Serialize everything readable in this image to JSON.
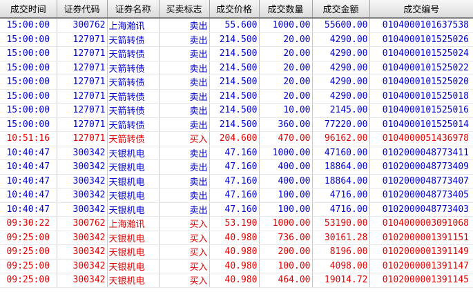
{
  "columns": [
    "成交时间",
    "证券代码",
    "证券名称",
    "买卖标志",
    "成交价格",
    "成交数量",
    "成交金额",
    "成交编号"
  ],
  "colors": {
    "sell": "#0000d0",
    "buy": "#e00000"
  },
  "rows": [
    {
      "side": "sell",
      "time": "15:00:00",
      "code": "300762",
      "name": "上海瀚讯",
      "dir": "卖出",
      "price": "55.600",
      "qty": "1000.00",
      "amount": "55600.00",
      "no": "0104000101637538"
    },
    {
      "side": "sell",
      "time": "15:00:00",
      "code": "127071",
      "name": "天箭转债",
      "dir": "卖出",
      "price": "214.500",
      "qty": "20.00",
      "amount": "4290.00",
      "no": "0104000101525026"
    },
    {
      "side": "sell",
      "time": "15:00:00",
      "code": "127071",
      "name": "天箭转债",
      "dir": "卖出",
      "price": "214.500",
      "qty": "20.00",
      "amount": "4290.00",
      "no": "0104000101525024"
    },
    {
      "side": "sell",
      "time": "15:00:00",
      "code": "127071",
      "name": "天箭转债",
      "dir": "卖出",
      "price": "214.500",
      "qty": "20.00",
      "amount": "4290.00",
      "no": "0104000101525022"
    },
    {
      "side": "sell",
      "time": "15:00:00",
      "code": "127071",
      "name": "天箭转债",
      "dir": "卖出",
      "price": "214.500",
      "qty": "20.00",
      "amount": "4290.00",
      "no": "0104000101525020"
    },
    {
      "side": "sell",
      "time": "15:00:00",
      "code": "127071",
      "name": "天箭转债",
      "dir": "卖出",
      "price": "214.500",
      "qty": "20.00",
      "amount": "4290.00",
      "no": "0104000101525018"
    },
    {
      "side": "sell",
      "time": "15:00:00",
      "code": "127071",
      "name": "天箭转债",
      "dir": "卖出",
      "price": "214.500",
      "qty": "10.00",
      "amount": "2145.00",
      "no": "0104000101525016"
    },
    {
      "side": "sell",
      "time": "15:00:00",
      "code": "127071",
      "name": "天箭转债",
      "dir": "卖出",
      "price": "214.500",
      "qty": "360.00",
      "amount": "77220.00",
      "no": "0104000101525014"
    },
    {
      "side": "buy",
      "time": "10:51:16",
      "code": "127071",
      "name": "天箭转债",
      "dir": "买入",
      "price": "204.600",
      "qty": "470.00",
      "amount": "96162.00",
      "no": "0104000051436978"
    },
    {
      "side": "sell",
      "time": "10:40:47",
      "code": "300342",
      "name": "天银机电",
      "dir": "卖出",
      "price": "47.160",
      "qty": "1000.00",
      "amount": "47160.00",
      "no": "0102000048773411"
    },
    {
      "side": "sell",
      "time": "10:40:47",
      "code": "300342",
      "name": "天银机电",
      "dir": "卖出",
      "price": "47.160",
      "qty": "400.00",
      "amount": "18864.00",
      "no": "0102000048773409"
    },
    {
      "side": "sell",
      "time": "10:40:47",
      "code": "300342",
      "name": "天银机电",
      "dir": "卖出",
      "price": "47.160",
      "qty": "400.00",
      "amount": "18864.00",
      "no": "0102000048773407"
    },
    {
      "side": "sell",
      "time": "10:40:47",
      "code": "300342",
      "name": "天银机电",
      "dir": "卖出",
      "price": "47.160",
      "qty": "100.00",
      "amount": "4716.00",
      "no": "0102000048773405"
    },
    {
      "side": "sell",
      "time": "10:40:47",
      "code": "300342",
      "name": "天银机电",
      "dir": "卖出",
      "price": "47.160",
      "qty": "100.00",
      "amount": "4716.00",
      "no": "0102000048773403"
    },
    {
      "side": "buy",
      "time": "09:30:22",
      "code": "300762",
      "name": "上海瀚讯",
      "dir": "买入",
      "price": "53.190",
      "qty": "1000.00",
      "amount": "53190.00",
      "no": "0104000003091068"
    },
    {
      "side": "buy",
      "time": "09:25:00",
      "code": "300342",
      "name": "天银机电",
      "dir": "买入",
      "price": "40.980",
      "qty": "736.00",
      "amount": "30161.28",
      "no": "0102000001391151"
    },
    {
      "side": "buy",
      "time": "09:25:00",
      "code": "300342",
      "name": "天银机电",
      "dir": "买入",
      "price": "40.980",
      "qty": "200.00",
      "amount": "8196.00",
      "no": "0102000001391149"
    },
    {
      "side": "buy",
      "time": "09:25:00",
      "code": "300342",
      "name": "天银机电",
      "dir": "买入",
      "price": "40.980",
      "qty": "100.00",
      "amount": "4098.00",
      "no": "0102000001391147"
    },
    {
      "side": "buy",
      "time": "09:25:00",
      "code": "300342",
      "name": "天银机电",
      "dir": "买入",
      "price": "40.980",
      "qty": "464.00",
      "amount": "19014.72",
      "no": "0102000001391145"
    }
  ]
}
